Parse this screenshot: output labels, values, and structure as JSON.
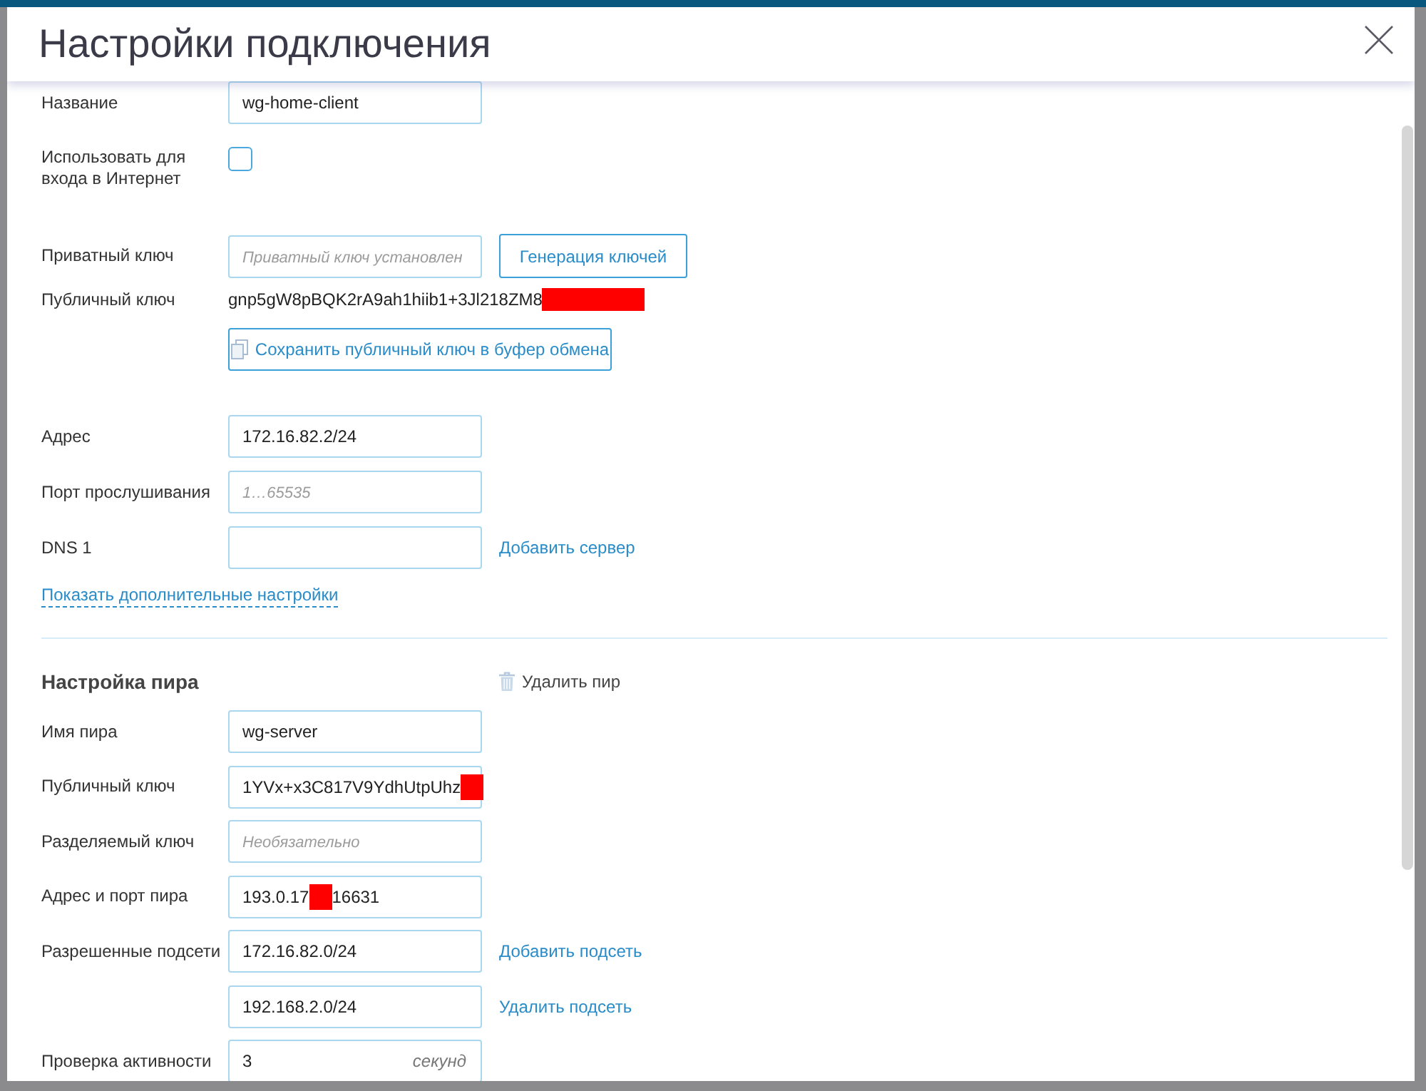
{
  "dialog": {
    "title": "Настройки подключения"
  },
  "connection": {
    "groups": [
      [
        {
          "kind": "input",
          "label": "Название",
          "value": "wg-home-client"
        },
        {
          "kind": "checkbox",
          "label": "Использовать для входа в Интернет",
          "checked": false
        }
      ],
      [
        {
          "kind": "input",
          "label": "Приватный ключ",
          "placeholder": "Приватный ключ установлен",
          "action": {
            "kind": "button",
            "label": "Генерация ключей"
          }
        },
        {
          "kind": "text",
          "label": "Публичный ключ",
          "value": "gnp5gW8pBQK2rA9ah1hiib1+3Jl218ZM8",
          "redacted": true
        },
        {
          "kind": "copy_button",
          "text": "Сохранить публичный ключ в буфер обмена"
        }
      ],
      [
        {
          "kind": "input",
          "label": "Адрес",
          "value": "172.16.82.2/24"
        },
        {
          "kind": "input",
          "label": "Порт прослушивания",
          "placeholder": "1…65535"
        },
        {
          "kind": "input",
          "label": "DNS 1",
          "action": {
            "kind": "link",
            "label": "Добавить сервер"
          }
        }
      ]
    ],
    "more_link": "Показать дополнительные настройки"
  },
  "peer": {
    "title": "Настройка пира",
    "delete_label": "Удалить пир",
    "rows": [
      {
        "kind": "input",
        "label": "Имя пира",
        "value": "wg-server"
      },
      {
        "kind": "input",
        "label": "Публичный ключ",
        "value": "1YVx+x3C817V9YdhUtpUhz",
        "redacted": true
      },
      {
        "kind": "input",
        "label": "Разделяемый ключ",
        "placeholder": "Необязательно"
      },
      {
        "kind": "input",
        "label": "Адрес и порт пира",
        "value": "193.0.17",
        "redacted": true,
        "value_end": "16631"
      },
      {
        "kind": "input",
        "label": "Разрешенные подсети",
        "value": "172.16.82.0/24",
        "action": {
          "kind": "link",
          "label": "Добавить подсеть"
        }
      },
      {
        "kind": "input",
        "value": "192.168.2.0/24",
        "action": {
          "kind": "link",
          "label": "Удалить подсеть"
        }
      },
      {
        "kind": "input",
        "label": "Проверка активности",
        "value": "3",
        "unit": "секунд"
      }
    ]
  }
}
